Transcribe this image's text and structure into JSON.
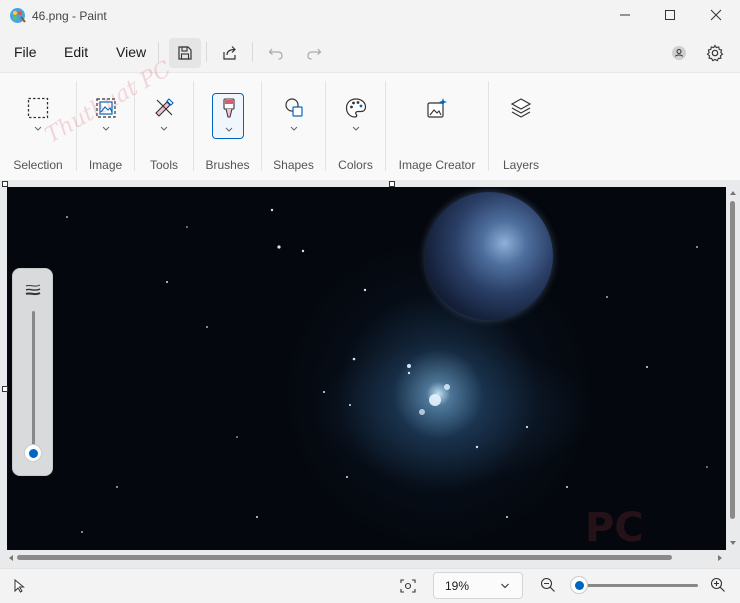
{
  "window": {
    "title": "46.png - Paint"
  },
  "menu": {
    "file": "File",
    "edit": "Edit",
    "view": "View"
  },
  "ribbon": {
    "groups": [
      {
        "label": "Selection",
        "icon": "selection-icon"
      },
      {
        "label": "Image",
        "icon": "image-icon"
      },
      {
        "label": "Tools",
        "icon": "tools-icon"
      },
      {
        "label": "Brushes",
        "icon": "brush-icon"
      },
      {
        "label": "Shapes",
        "icon": "shapes-icon"
      },
      {
        "label": "Colors",
        "icon": "palette-icon"
      },
      {
        "label": "Image Creator",
        "icon": "image-creator-icon"
      },
      {
        "label": "Layers",
        "icon": "layers-icon"
      }
    ]
  },
  "status": {
    "zoom_value": "19%"
  },
  "watermark": {
    "text": "Thuthuat PC",
    "logo": "PC"
  },
  "colors": {
    "accent": "#0067c0",
    "canvas_bg": "#04070d"
  }
}
